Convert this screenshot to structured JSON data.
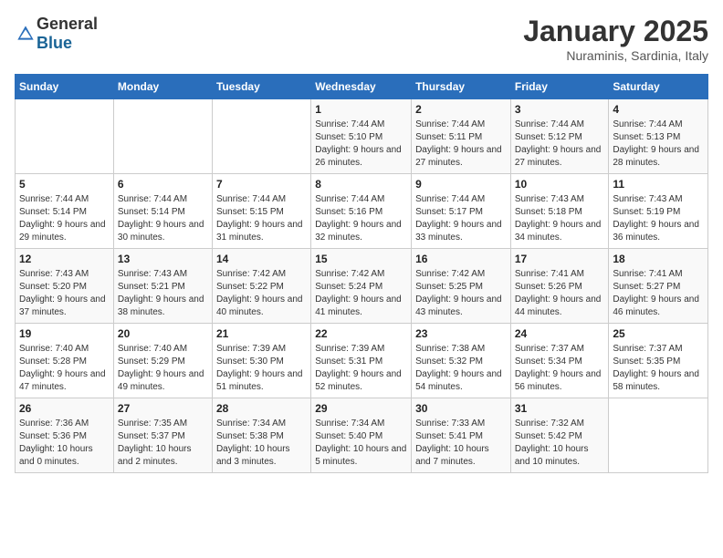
{
  "logo": {
    "general": "General",
    "blue": "Blue"
  },
  "title": "January 2025",
  "subtitle": "Nuraminis, Sardinia, Italy",
  "days_of_week": [
    "Sunday",
    "Monday",
    "Tuesday",
    "Wednesday",
    "Thursday",
    "Friday",
    "Saturday"
  ],
  "weeks": [
    [
      {
        "day": "",
        "info": ""
      },
      {
        "day": "",
        "info": ""
      },
      {
        "day": "",
        "info": ""
      },
      {
        "day": "1",
        "info": "Sunrise: 7:44 AM\nSunset: 5:10 PM\nDaylight: 9 hours and 26 minutes."
      },
      {
        "day": "2",
        "info": "Sunrise: 7:44 AM\nSunset: 5:11 PM\nDaylight: 9 hours and 27 minutes."
      },
      {
        "day": "3",
        "info": "Sunrise: 7:44 AM\nSunset: 5:12 PM\nDaylight: 9 hours and 27 minutes."
      },
      {
        "day": "4",
        "info": "Sunrise: 7:44 AM\nSunset: 5:13 PM\nDaylight: 9 hours and 28 minutes."
      }
    ],
    [
      {
        "day": "5",
        "info": "Sunrise: 7:44 AM\nSunset: 5:14 PM\nDaylight: 9 hours and 29 minutes."
      },
      {
        "day": "6",
        "info": "Sunrise: 7:44 AM\nSunset: 5:14 PM\nDaylight: 9 hours and 30 minutes."
      },
      {
        "day": "7",
        "info": "Sunrise: 7:44 AM\nSunset: 5:15 PM\nDaylight: 9 hours and 31 minutes."
      },
      {
        "day": "8",
        "info": "Sunrise: 7:44 AM\nSunset: 5:16 PM\nDaylight: 9 hours and 32 minutes."
      },
      {
        "day": "9",
        "info": "Sunrise: 7:44 AM\nSunset: 5:17 PM\nDaylight: 9 hours and 33 minutes."
      },
      {
        "day": "10",
        "info": "Sunrise: 7:43 AM\nSunset: 5:18 PM\nDaylight: 9 hours and 34 minutes."
      },
      {
        "day": "11",
        "info": "Sunrise: 7:43 AM\nSunset: 5:19 PM\nDaylight: 9 hours and 36 minutes."
      }
    ],
    [
      {
        "day": "12",
        "info": "Sunrise: 7:43 AM\nSunset: 5:20 PM\nDaylight: 9 hours and 37 minutes."
      },
      {
        "day": "13",
        "info": "Sunrise: 7:43 AM\nSunset: 5:21 PM\nDaylight: 9 hours and 38 minutes."
      },
      {
        "day": "14",
        "info": "Sunrise: 7:42 AM\nSunset: 5:22 PM\nDaylight: 9 hours and 40 minutes."
      },
      {
        "day": "15",
        "info": "Sunrise: 7:42 AM\nSunset: 5:24 PM\nDaylight: 9 hours and 41 minutes."
      },
      {
        "day": "16",
        "info": "Sunrise: 7:42 AM\nSunset: 5:25 PM\nDaylight: 9 hours and 43 minutes."
      },
      {
        "day": "17",
        "info": "Sunrise: 7:41 AM\nSunset: 5:26 PM\nDaylight: 9 hours and 44 minutes."
      },
      {
        "day": "18",
        "info": "Sunrise: 7:41 AM\nSunset: 5:27 PM\nDaylight: 9 hours and 46 minutes."
      }
    ],
    [
      {
        "day": "19",
        "info": "Sunrise: 7:40 AM\nSunset: 5:28 PM\nDaylight: 9 hours and 47 minutes."
      },
      {
        "day": "20",
        "info": "Sunrise: 7:40 AM\nSunset: 5:29 PM\nDaylight: 9 hours and 49 minutes."
      },
      {
        "day": "21",
        "info": "Sunrise: 7:39 AM\nSunset: 5:30 PM\nDaylight: 9 hours and 51 minutes."
      },
      {
        "day": "22",
        "info": "Sunrise: 7:39 AM\nSunset: 5:31 PM\nDaylight: 9 hours and 52 minutes."
      },
      {
        "day": "23",
        "info": "Sunrise: 7:38 AM\nSunset: 5:32 PM\nDaylight: 9 hours and 54 minutes."
      },
      {
        "day": "24",
        "info": "Sunrise: 7:37 AM\nSunset: 5:34 PM\nDaylight: 9 hours and 56 minutes."
      },
      {
        "day": "25",
        "info": "Sunrise: 7:37 AM\nSunset: 5:35 PM\nDaylight: 9 hours and 58 minutes."
      }
    ],
    [
      {
        "day": "26",
        "info": "Sunrise: 7:36 AM\nSunset: 5:36 PM\nDaylight: 10 hours and 0 minutes."
      },
      {
        "day": "27",
        "info": "Sunrise: 7:35 AM\nSunset: 5:37 PM\nDaylight: 10 hours and 2 minutes."
      },
      {
        "day": "28",
        "info": "Sunrise: 7:34 AM\nSunset: 5:38 PM\nDaylight: 10 hours and 3 minutes."
      },
      {
        "day": "29",
        "info": "Sunrise: 7:34 AM\nSunset: 5:40 PM\nDaylight: 10 hours and 5 minutes."
      },
      {
        "day": "30",
        "info": "Sunrise: 7:33 AM\nSunset: 5:41 PM\nDaylight: 10 hours and 7 minutes."
      },
      {
        "day": "31",
        "info": "Sunrise: 7:32 AM\nSunset: 5:42 PM\nDaylight: 10 hours and 10 minutes."
      },
      {
        "day": "",
        "info": ""
      }
    ]
  ]
}
